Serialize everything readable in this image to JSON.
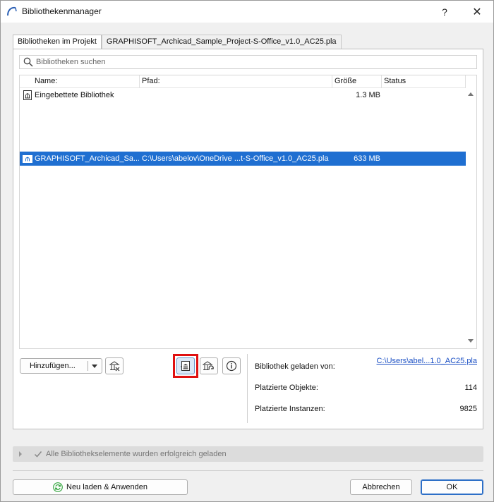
{
  "window": {
    "title": "Bibliothekenmanager",
    "help_glyph": "?",
    "close_glyph": "✕"
  },
  "tabs": [
    {
      "label": "Bibliotheken im Projekt",
      "active": true
    },
    {
      "label": "GRAPHISOFT_Archicad_Sample_Project-S-Office_v1.0_AC25.pla",
      "active": false
    }
  ],
  "search": {
    "placeholder": "Bibliotheken suchen",
    "value": ""
  },
  "table": {
    "columns": [
      "Name:",
      "Pfad:",
      "Größe",
      "Status"
    ],
    "rows": [
      {
        "name": "Eingebettete Bibliothek",
        "path": "",
        "size": "1.3 MB",
        "status": "",
        "selected": false,
        "icon": "embedded-library-icon"
      },
      {
        "name": "GRAPHISOFT_Archicad_Sa...",
        "path": "C:\\Users\\abelov\\OneDrive ...t-S-Office_v1.0_AC25.pla",
        "size": "633 MB",
        "status": "",
        "selected": true,
        "icon": "library-container-icon"
      }
    ]
  },
  "actions": {
    "add_label": "Hinzufügen...",
    "remove_icon": "remove-library-icon",
    "relink_icon": "relink-library-icon",
    "hotlink_icon": "hotlink-library-icon",
    "info_icon": "info-icon"
  },
  "details": {
    "loaded_from_label": "Bibliothek geladen von:",
    "loaded_from_value": "C:\\Users\\abel...1.0_AC25.pla",
    "placed_objects_label": "Platzierte Objekte:",
    "placed_objects_value": "114",
    "placed_instances_label": "Platzierte Instanzen:",
    "placed_instances_value": "9825"
  },
  "status": {
    "text": "Alle Bibliothekselemente wurden erfolgreich geladen"
  },
  "footer": {
    "reload_label": "Neu laden & Anwenden",
    "cancel_label": "Abbrechen",
    "ok_label": "OK"
  },
  "colors": {
    "selection": "#1f6fd1",
    "highlight_frame": "#e01010",
    "link": "#1a4fc4",
    "reload_icon": "#3aa845"
  }
}
